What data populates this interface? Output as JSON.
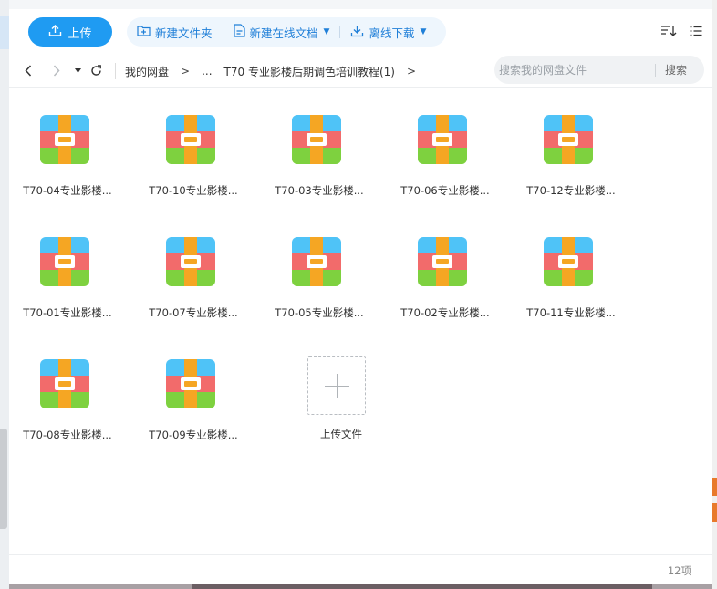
{
  "colors": {
    "accent": "#1f9bf2",
    "link": "#1f7fd8",
    "archive_top": "#4fc3f7",
    "archive_mid": "#f26b6b",
    "archive_bottom": "#7ed13f",
    "archive_strap": "#f5a623"
  },
  "toolbar": {
    "upload_label": "上传",
    "new_folder_label": "新建文件夹",
    "new_online_doc_label": "新建在线文档",
    "offline_download_label": "离线下载"
  },
  "breadcrumb": {
    "root": "我的网盘",
    "ellipsis": "...",
    "current": "T70 专业影楼后期调色培训教程(1)",
    "separator": ">"
  },
  "search": {
    "placeholder": "搜索我的网盘文件",
    "button_label": "搜索"
  },
  "files": [
    {
      "name": "T70-04专业影楼..."
    },
    {
      "name": "T70-10专业影楼..."
    },
    {
      "name": "T70-03专业影楼..."
    },
    {
      "name": "T70-06专业影楼..."
    },
    {
      "name": "T70-12专业影楼..."
    },
    {
      "name": "T70-01专业影楼..."
    },
    {
      "name": "T70-07专业影楼..."
    },
    {
      "name": "T70-05专业影楼..."
    },
    {
      "name": "T70-02专业影楼..."
    },
    {
      "name": "T70-11专业影楼..."
    },
    {
      "name": "T70-08专业影楼..."
    },
    {
      "name": "T70-09专业影楼..."
    }
  ],
  "upload_tile_label": "上传文件",
  "status": {
    "item_count": "12项"
  }
}
